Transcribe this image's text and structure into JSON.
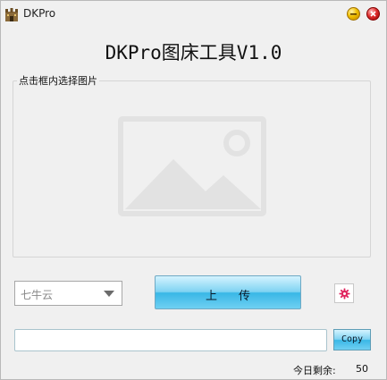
{
  "window": {
    "title": "DKPro",
    "icon": "castle-icon"
  },
  "app": {
    "heading": "DKPro图床工具V1.0"
  },
  "image_area": {
    "legend": "点击框内选择图片",
    "placeholder_icon": "image-placeholder-icon"
  },
  "storage_select": {
    "value": "七牛云"
  },
  "upload_button": {
    "label": "上传"
  },
  "url_field": {
    "value": ""
  },
  "copy_button": {
    "label": "Copy"
  },
  "status": {
    "remaining_label": "今日剩余:",
    "remaining_value": "50"
  },
  "colors": {
    "button_gradient_top": "#d4f3ff",
    "button_gradient_mid": "#39b7e6",
    "settings_icon": "#e0245e"
  }
}
